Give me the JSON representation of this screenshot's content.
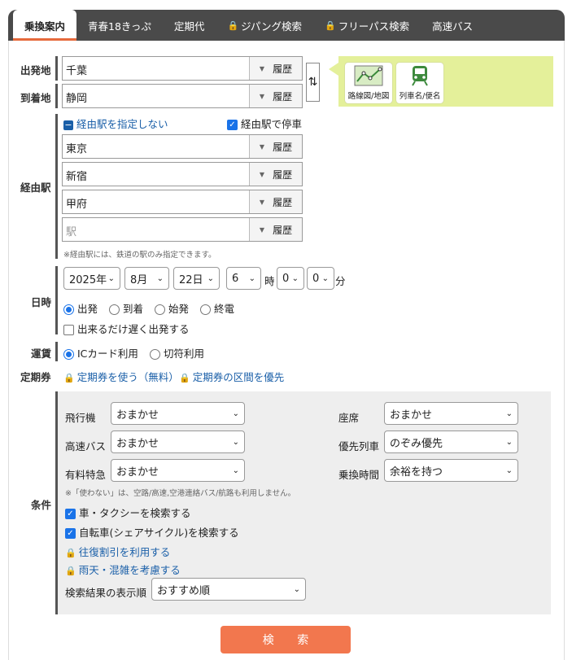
{
  "tabs": [
    {
      "label": "乗換案内",
      "locked": false
    },
    {
      "label": "青春18きっぷ",
      "locked": false
    },
    {
      "label": "定期代",
      "locked": false
    },
    {
      "label": "ジパング検索",
      "locked": true
    },
    {
      "label": "フリーパス検索",
      "locked": true
    },
    {
      "label": "高速バス",
      "locked": false
    }
  ],
  "labels": {
    "departure": "出発地",
    "arrival": "到着地",
    "via": "経由駅",
    "datetime": "日時",
    "fare": "運賃",
    "pass": "定期券",
    "conditions": "条件"
  },
  "departure_value": "千葉",
  "arrival_value": "静岡",
  "history_label": "履歴",
  "side_buttons": {
    "route_map": "路線図/地図",
    "train_name": "列車名/便名"
  },
  "via": {
    "no_via_link": "経由駅を指定しない",
    "stop_at_via": "経由駅で停車",
    "stations": [
      "東京",
      "新宿",
      "甲府"
    ],
    "placeholder": "駅",
    "note": "※経由駅には、鉄道の駅のみ指定できます。"
  },
  "datetime": {
    "year": "2025年",
    "month": "8月",
    "day": "22日",
    "hour": "6",
    "hour_unit": "時",
    "min_tens": "0",
    "min_ones": "0",
    "min_unit": "分",
    "modes": [
      "出発",
      "到着",
      "始発",
      "終電"
    ],
    "selected_mode": "出発",
    "late_departure": "出来るだけ遅く出発する"
  },
  "fare": {
    "options": [
      "ICカード利用",
      "切符利用"
    ],
    "selected": "ICカード利用"
  },
  "pass": {
    "use_pass": "定期券を使う（無料）",
    "prefer_pass": "定期券の区間を優先"
  },
  "conditions": {
    "airplane_label": "飛行機",
    "airplane_value": "おまかせ",
    "bus_label": "高速バス",
    "bus_value": "おまかせ",
    "express_label": "有料特急",
    "express_value": "おまかせ",
    "seat_label": "座席",
    "seat_value": "おまかせ",
    "priority_label": "優先列車",
    "priority_value": "のぞみ優先",
    "transfer_label": "乗換時間",
    "transfer_value": "余裕を持つ",
    "note": "※「使わない」は、空路/高速,空港連絡バス/航路も利用しません。",
    "car_taxi": "車・タクシーを検索する",
    "bicycle": "自転車(シェアサイクル)を検索する",
    "round_trip": "往復割引を利用する",
    "weather": "雨天・混雑を考慮する",
    "sort_label": "検索結果の表示順",
    "sort_value": "おすすめ順"
  },
  "search_button": "検 索",
  "colors": {
    "accent": "#e66a3c",
    "search": "#f2774e",
    "link": "#1a5fa8",
    "tabbar": "#4a4a4a",
    "green_panel": "#e4f09a"
  }
}
